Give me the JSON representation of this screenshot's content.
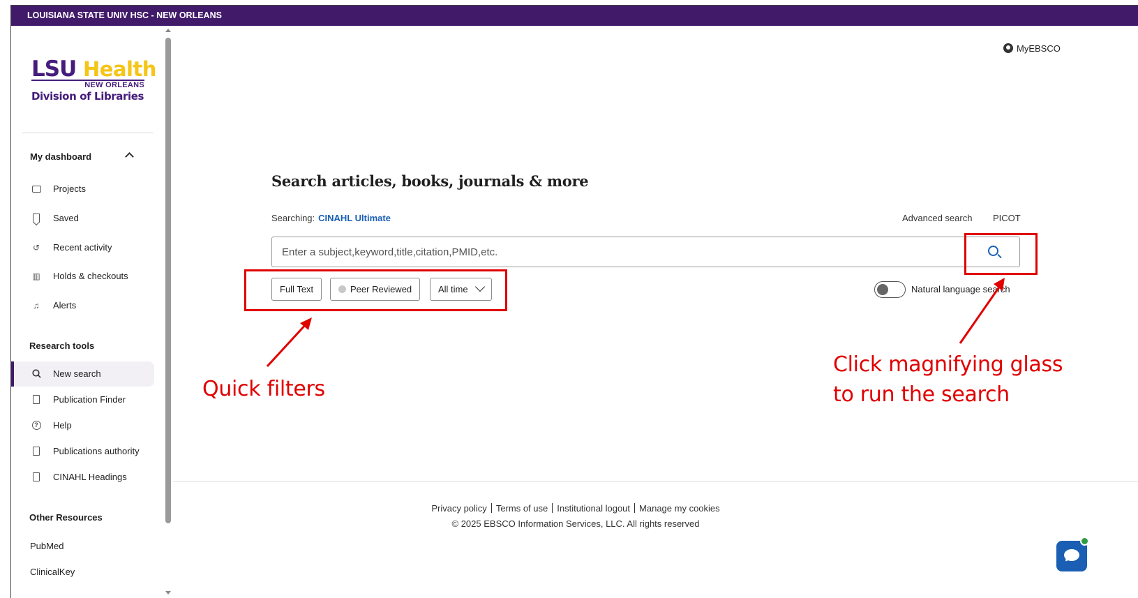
{
  "topbar": {
    "institution": "LOUISIANA STATE UNIV HSC - NEW ORLEANS"
  },
  "logo": {
    "lsu": "LSU",
    "health": "Health",
    "new_orleans": "NEW ORLEANS",
    "division": "Division of Libraries"
  },
  "sidebar": {
    "dashboard_heading": "My dashboard",
    "dashboard_items": [
      {
        "label": "Projects",
        "icon": "folder-icon"
      },
      {
        "label": "Saved",
        "icon": "bookmark-icon"
      },
      {
        "label": "Recent activity",
        "icon": "history-icon"
      },
      {
        "label": "Holds & checkouts",
        "icon": "books-icon"
      },
      {
        "label": "Alerts",
        "icon": "bell-icon"
      }
    ],
    "research_heading": "Research tools",
    "research_items": [
      {
        "label": "New search",
        "icon": "search-icon",
        "active": true
      },
      {
        "label": "Publication Finder",
        "icon": "document-icon"
      },
      {
        "label": "Help",
        "icon": "help-icon"
      },
      {
        "label": "Publications authority",
        "icon": "authority-icon"
      },
      {
        "label": "CINAHL Headings",
        "icon": "headings-icon"
      }
    ],
    "other_heading": "Other Resources",
    "other_items": [
      "PubMed",
      "ClinicalKey"
    ]
  },
  "header": {
    "myebsco": "MyEBSCO"
  },
  "search": {
    "headline": "Search articles, books, journals & more",
    "searching_label": "Searching:",
    "database": "CINAHL Ultimate",
    "advanced": "Advanced search",
    "picot": "PICOT",
    "placeholder": "Enter a subject,keyword,title,citation,PMID,etc.",
    "filters": {
      "full_text": "Full Text",
      "peer_reviewed": "Peer Reviewed",
      "time": "All time"
    },
    "natural_language": "Natural language search"
  },
  "annotations": {
    "quick_filters": "Quick filters",
    "magnifier_line1": "Click magnifying glass",
    "magnifier_line2": "to run the search",
    "color": "#e00000"
  },
  "footer": {
    "links": [
      "Privacy policy",
      "Terms of use",
      "Institutional logout",
      "Manage my cookies"
    ],
    "copyright": "© 2025 EBSCO Information Services, LLC. All rights reserved"
  },
  "colors": {
    "brand_purple": "#411b6a",
    "link_blue": "#1a5fb4",
    "logo_gold": "#f5c518"
  }
}
